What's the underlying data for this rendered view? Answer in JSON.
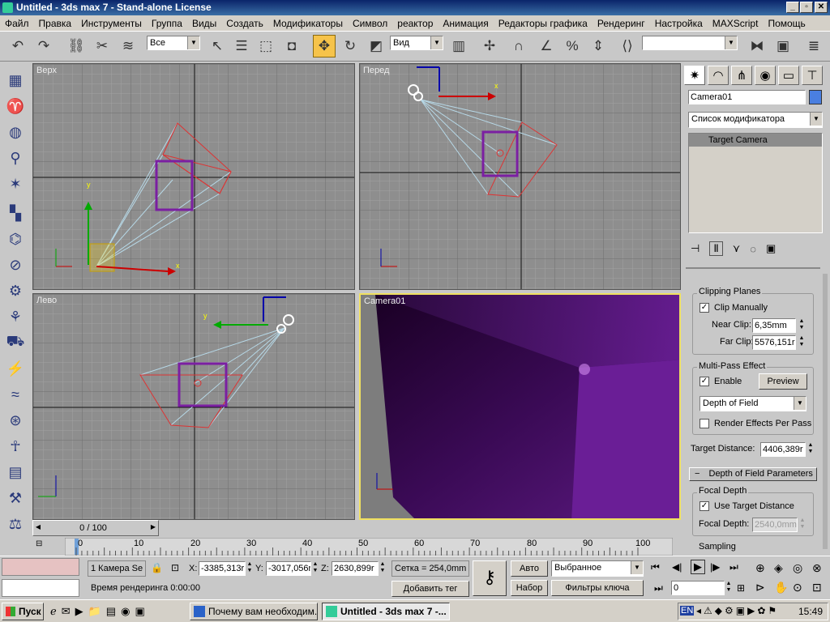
{
  "window": {
    "title": "Untitled - 3ds max 7 - Stand-alone License",
    "min": "_",
    "max": "▫",
    "close": "✕"
  },
  "menu": [
    "Файл",
    "Правка",
    "Инструменты",
    "Группа",
    "Виды",
    "Создать",
    "Модификаторы",
    "Символ",
    "реактор",
    "Анимация",
    "Редакторы графика",
    "Рендеринг",
    "Настройка",
    "MAXScript",
    "Помощь"
  ],
  "toolbar": {
    "selection_filter": "Все",
    "ref_coord": "Вид",
    "named_selection": ""
  },
  "viewports": {
    "top": "Верх",
    "front": "Перед",
    "left": "Лево",
    "camera": "Camera01"
  },
  "axes": {
    "x": "x",
    "y": "y",
    "z": "z"
  },
  "command_panel": {
    "object_name": "Camera01",
    "object_color": "#4a7fe0",
    "modifier_list": "Список модификатора",
    "stack_item": "Target Camera",
    "clipping": {
      "title": "Clipping Planes",
      "clip_manually": "Clip Manually",
      "near_label": "Near Clip:",
      "near_value": "6,35mm",
      "far_label": "Far Clip:",
      "far_value": "5576,151r"
    },
    "multipass": {
      "title": "Multi-Pass Effect",
      "enable": "Enable",
      "preview": "Preview",
      "effect": "Depth of Field",
      "render_per_pass": "Render Effects Per Pass"
    },
    "target_distance_label": "Target Distance:",
    "target_distance_value": "4406,389r",
    "dof_rollout": "Depth of Field Parameters",
    "dof_rollout_sign": "−",
    "focal": {
      "title": "Focal Depth",
      "use_target": "Use Target Distance",
      "depth_label": "Focal Depth:",
      "depth_value": "2540,0mm"
    },
    "sampling": "Sampling"
  },
  "timeline": {
    "frame": "0 / 100",
    "ticks": [
      "0",
      "10",
      "20",
      "30",
      "40",
      "50",
      "60",
      "70",
      "80",
      "90",
      "100"
    ]
  },
  "status": {
    "selection": "1 Камера Se",
    "x_label": "X:",
    "x": "-3385,313r",
    "y_label": "Y:",
    "y": "-3017,056r",
    "z_label": "Z:",
    "z": "2630,899r",
    "grid": "Сетка = 254,0mm",
    "render_time": "Время рендеринга  0:00:00",
    "add_tag": "Добавить тег",
    "auto": "Авто",
    "set": "Набор",
    "selected": "Выбранное",
    "key_filters": "Фильтры ключа",
    "current_frame": "0"
  },
  "taskbar": {
    "start": "Пуск",
    "tasks": [
      "Почему вам необходим...",
      "Untitled - 3ds max 7 -..."
    ],
    "lang": "EN",
    "clock": "15:49"
  }
}
